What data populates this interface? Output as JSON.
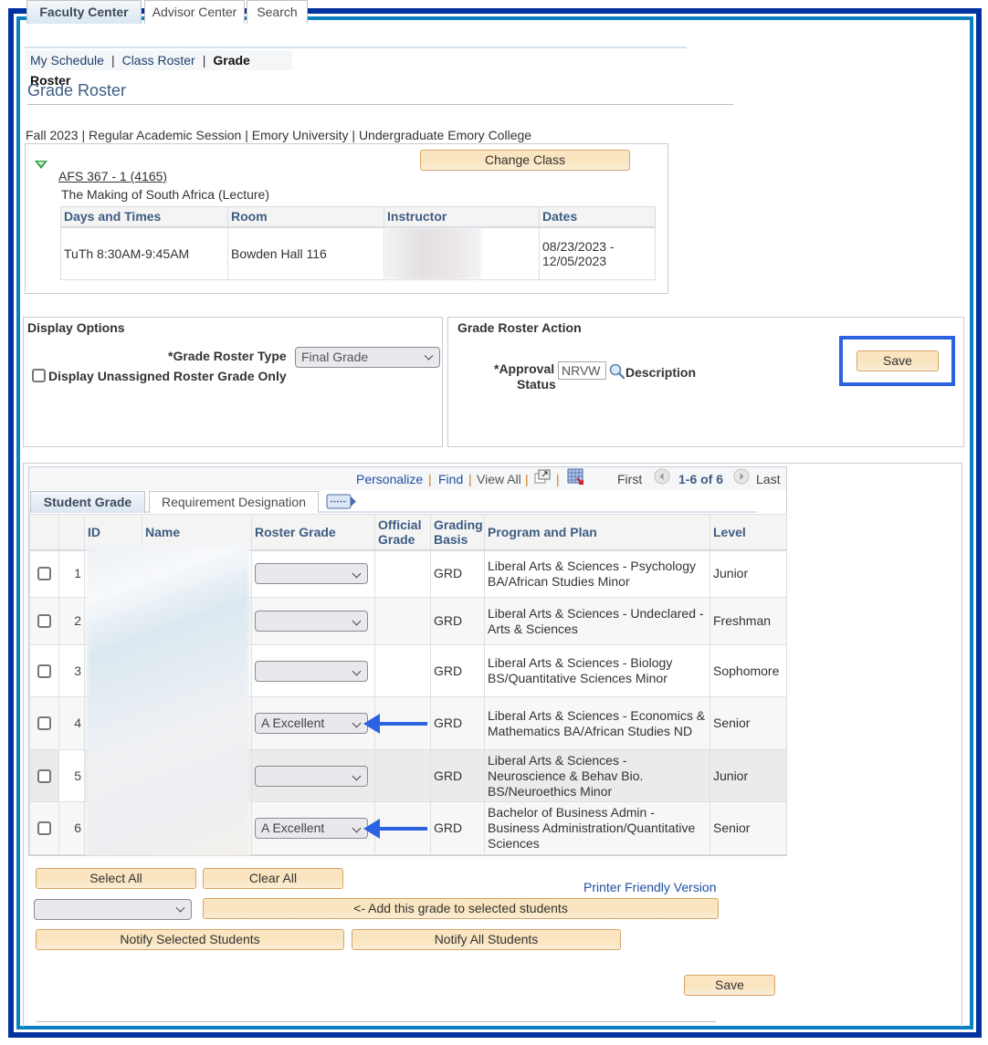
{
  "colors": {
    "frame_outer": "#0033a0",
    "frame_inner": "#0a7fc1",
    "annotation_blue": "#2d62e0",
    "link_blue": "#1f4f9e",
    "header_blue": "#3d5c82"
  },
  "top_tabs": [
    {
      "label": "Faculty Center",
      "active": true
    },
    {
      "label": "Advisor Center",
      "active": false
    },
    {
      "label": "Search",
      "active": false
    }
  ],
  "subnav": {
    "items": [
      "My Schedule",
      "Class Roster",
      "Grade Roster"
    ],
    "separator": "|"
  },
  "page_title": "Grade Roster",
  "term_line": "Fall 2023 | Regular Academic Session | Emory University | Undergraduate Emory College",
  "class_info": {
    "class_link": "AFS 367 - 1 (4165)",
    "description": "The Making of South Africa (Lecture)",
    "change_class_label": "Change Class",
    "meeting_headers": [
      "Days and Times",
      "Room",
      "Instructor",
      "Dates"
    ],
    "meeting_row": {
      "days_times": "TuTh 8:30AM-9:45AM",
      "room": "Bowden Hall 116",
      "instructor": "",
      "dates_line1": "08/23/2023 -",
      "dates_line2": "12/05/2023"
    }
  },
  "display_options": {
    "title": "Display Options",
    "roster_type_label": "*Grade Roster Type",
    "roster_type_value": "Final Grade",
    "unassigned_label": "Display Unassigned Roster Grade Only"
  },
  "roster_action": {
    "title": "Grade Roster Action",
    "approval_label_1": "*Approval",
    "approval_label_2": "Status",
    "approval_value": "NRVW",
    "description_label": "Description",
    "save_label": "Save"
  },
  "grid": {
    "nav": {
      "personalize": "Personalize",
      "find": "Find",
      "view_all": "View All",
      "first": "First",
      "range": "1-6 of 6",
      "last": "Last",
      "sep": "|"
    },
    "tabs": [
      {
        "label": "Student Grade",
        "active": true
      },
      {
        "label": "Requirement Designation",
        "active": false
      }
    ],
    "headers": {
      "id": "ID",
      "name": "Name",
      "roster_grade": "Roster Grade",
      "official_grade_1": "Official",
      "official_grade_2": "Grade",
      "grading_basis_1": "Grading",
      "grading_basis_2": "Basis",
      "program": "Program and Plan",
      "level": "Level"
    },
    "rows": [
      {
        "num": "1",
        "grade": "",
        "official": "",
        "basis": "GRD",
        "program": "Liberal Arts & Sciences - Psychology BA/African Studies Minor",
        "level": "Junior"
      },
      {
        "num": "2",
        "grade": "",
        "official": "",
        "basis": "GRD",
        "program": "Liberal Arts & Sciences - Undeclared - Arts & Sciences",
        "level": "Freshman"
      },
      {
        "num": "3",
        "grade": "",
        "official": "",
        "basis": "GRD",
        "program": "Liberal Arts & Sciences - Biology BS/Quantitative Sciences Minor",
        "level": "Sophomore"
      },
      {
        "num": "4",
        "grade": "A Excellent",
        "official": "",
        "basis": "GRD",
        "program": "Liberal Arts & Sciences - Economics & Mathematics BA/African Studies ND",
        "level": "Senior"
      },
      {
        "num": "5",
        "grade": "",
        "official": "",
        "basis": "GRD",
        "program": "Liberal Arts & Sciences - Neuroscience & Behav Bio. BS/Neuroethics Minor",
        "level": "Junior"
      },
      {
        "num": "6",
        "grade": "A Excellent",
        "official": "",
        "basis": "GRD",
        "program": "Bachelor of Business Admin - Business Administration/Quantitative Sciences",
        "level": "Senior"
      }
    ]
  },
  "actions": {
    "select_all": "Select All",
    "clear_all": "Clear All",
    "printer_friendly": "Printer Friendly Version",
    "bulk_grade_value": "",
    "add_grade": "<- Add this grade to selected students",
    "notify_selected": "Notify Selected Students",
    "notify_all": "Notify All Students",
    "save": "Save"
  }
}
